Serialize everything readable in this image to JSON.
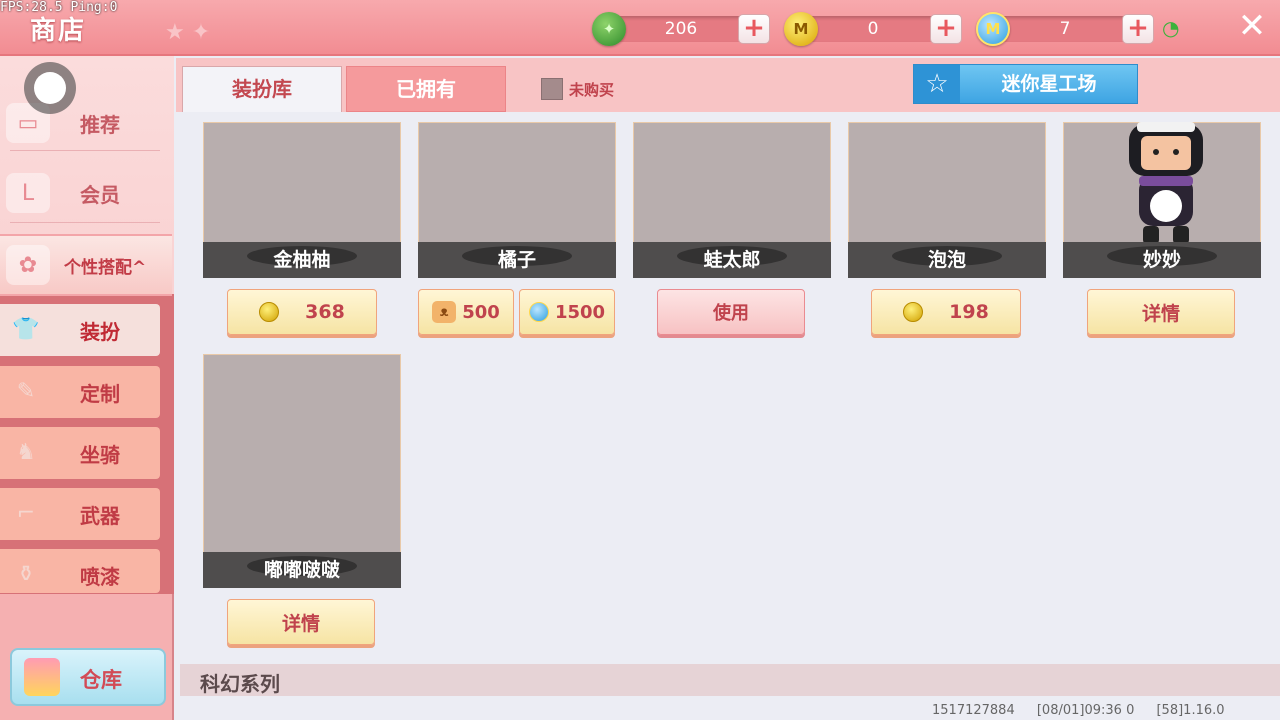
{
  "debug": {
    "fps_text": "FPS:28.5  Ping:0"
  },
  "header": {
    "title": "商店",
    "currencies": [
      {
        "name": "gem",
        "value": "206"
      },
      {
        "name": "coin",
        "value": "0"
      },
      {
        "name": "mini-coin",
        "value": "7"
      }
    ]
  },
  "sidebar": {
    "items": [
      {
        "label": "推荐"
      },
      {
        "label": "会员"
      },
      {
        "label": "个性搭配"
      }
    ],
    "expand_glyph": "^",
    "sub_items": [
      {
        "label": "装扮"
      },
      {
        "label": "定制"
      },
      {
        "label": "坐骑"
      },
      {
        "label": "武器"
      },
      {
        "label": "喷漆"
      }
    ],
    "warehouse_label": "仓库"
  },
  "tabs": {
    "library": "装扮库",
    "owned": "已拥有",
    "filter_label": "未购买",
    "workshop_label": "迷你星工场"
  },
  "items": [
    {
      "name": "金柚柚",
      "price": "368"
    },
    {
      "name": "橘子",
      "price_bear": "500",
      "price_mini": "1500"
    },
    {
      "name": "蛙太郎",
      "action": "使用"
    },
    {
      "name": "泡泡",
      "price": "198"
    },
    {
      "name": "妙妙",
      "action": "详情"
    },
    {
      "name": "嘟嘟啵啵",
      "action": "详情"
    }
  ],
  "series": {
    "title": "科幻系列"
  },
  "footer": {
    "uid": "1517127884",
    "datetime": "[08/01]09:36 0",
    "version": "[58]1.16.0"
  },
  "colors": {
    "accent": "#f28c92",
    "title_text": "#c0434d",
    "workshop": "#3ea4e3"
  }
}
